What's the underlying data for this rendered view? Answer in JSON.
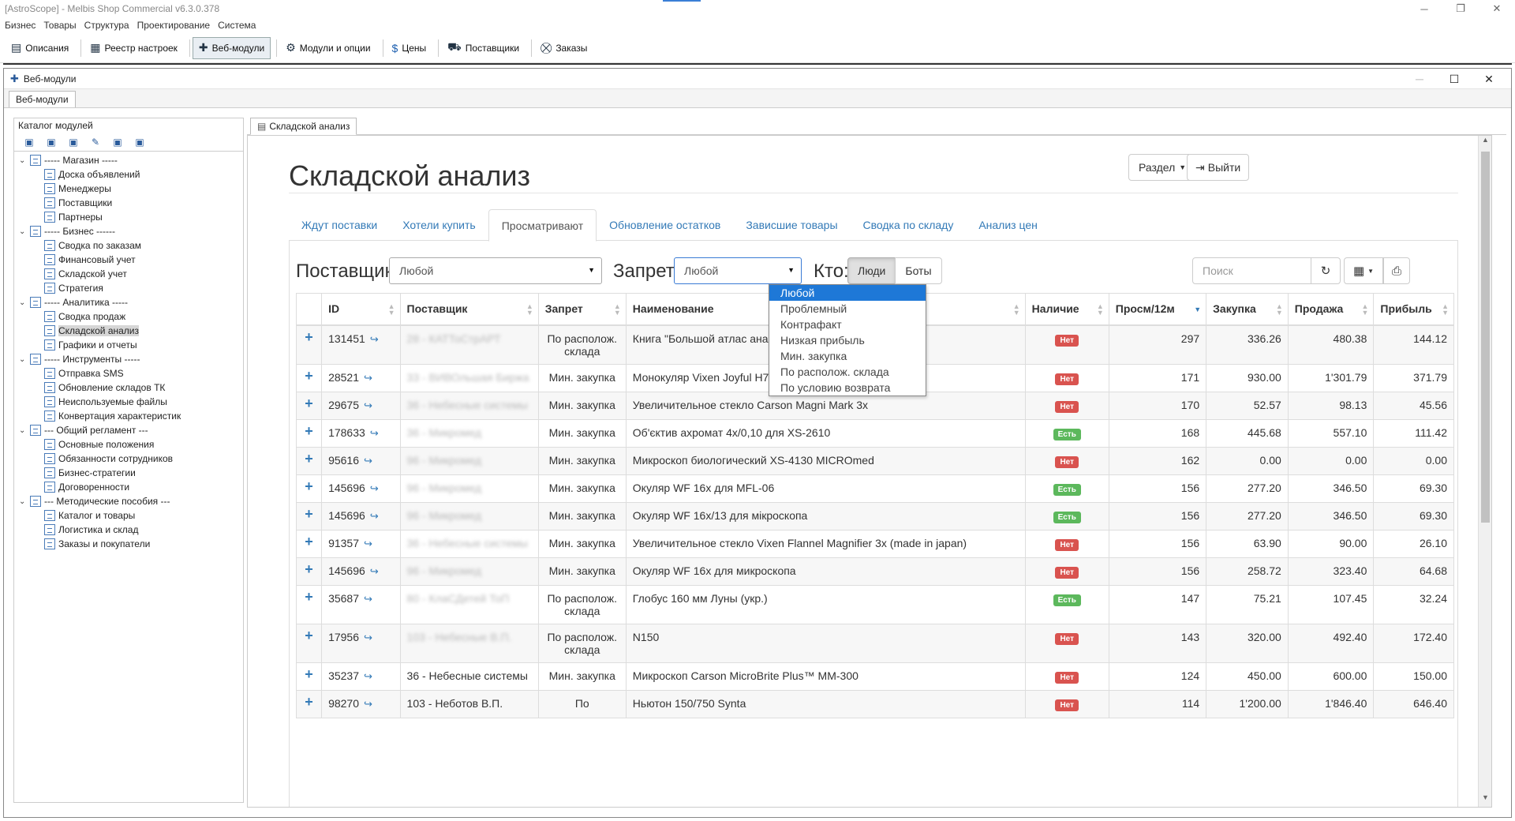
{
  "app": {
    "title": "[AstroScope] - Melbis Shop Commercial v6.3.0.378",
    "menu": [
      "Бизнес",
      "Товары",
      "Структура",
      "Проектирование",
      "Система"
    ],
    "toolbar": [
      {
        "icon": "doc-icon",
        "label": "Описания"
      },
      {
        "icon": "registry-icon",
        "label": "Реестр настроек"
      },
      {
        "icon": "puzzle-icon",
        "label": "Веб-модули",
        "active": true
      },
      {
        "icon": "gear-icon",
        "label": "Модули и опции"
      },
      {
        "icon": "dollar-icon",
        "label": "Цены"
      },
      {
        "icon": "truck-icon",
        "label": "Поставщики"
      },
      {
        "icon": "cart-icon",
        "label": "Заказы"
      }
    ]
  },
  "child": {
    "title": "Веб-модули",
    "tab": "Веб-модули",
    "catalog_title": "Каталог модулей",
    "right_tab": "Складской анализ"
  },
  "tree": [
    {
      "label": "----- Магазин -----",
      "group": true
    },
    {
      "label": "Доска объявлений"
    },
    {
      "label": "Менеджеры"
    },
    {
      "label": "Поставщики"
    },
    {
      "label": "Партнеры"
    },
    {
      "label": "----- Бизнес ------",
      "group": true
    },
    {
      "label": "Сводка по заказам"
    },
    {
      "label": "Финансовый учет"
    },
    {
      "label": "Складской учет"
    },
    {
      "label": "Стратегия"
    },
    {
      "label": "----- Аналитика -----",
      "group": true
    },
    {
      "label": "Сводка продаж"
    },
    {
      "label": "Складской анализ",
      "selected": true
    },
    {
      "label": "Графики и отчеты"
    },
    {
      "label": "----- Инструменты -----",
      "group": true
    },
    {
      "label": "Отправка SMS"
    },
    {
      "label": "Обновление складов ТК"
    },
    {
      "label": "Неиспользуемые файлы"
    },
    {
      "label": "Конвертация характеристик"
    },
    {
      "label": "--- Общий регламент ---",
      "group": true
    },
    {
      "label": "Основные положения"
    },
    {
      "label": "Обязанности сотрудников"
    },
    {
      "label": "Бизнес-стратегии"
    },
    {
      "label": "Договоренности"
    },
    {
      "label": "--- Методические пособия ---",
      "group": true
    },
    {
      "label": "Каталог и товары"
    },
    {
      "label": "Логистика и склад"
    },
    {
      "label": "Заказы и покупатели"
    }
  ],
  "page": {
    "title": "Складской анализ",
    "section_btn": "Раздел",
    "exit_btn": "Выйти",
    "tabs": [
      "Ждут поставки",
      "Хотели купить",
      "Просматривают",
      "Обновление остатков",
      "Зависшие товары",
      "Сводка по складу",
      "Анализ цен"
    ],
    "active_tab": 2,
    "filters": {
      "supplier_label": "Поставщик:",
      "supplier_value": "Любой",
      "ban_label": "Запрет:",
      "ban_value": "Любой",
      "who_label": "Кто:",
      "who_options": [
        "Люди",
        "Боты"
      ],
      "search_placeholder": "Поиск"
    },
    "ban_options": [
      "Любой",
      "Проблемный",
      "Контрафакт",
      "Низкая прибыль",
      "Мин. закупка",
      "По располож. склада",
      "По условию возврата"
    ],
    "columns": [
      "ID",
      "Поставщик",
      "Запрет",
      "Наименование",
      "Наличие",
      "Просм/12м",
      "Закупка",
      "Продажа",
      "Прибыль"
    ],
    "status": {
      "no": "Нет",
      "yes": "Есть"
    },
    "rows": [
      {
        "id": "131451",
        "supplier": "28 - КАТТоСтрАРТ",
        "blur": true,
        "ban": "По располож. склада",
        "name": "Книга \"Большой атлас ана",
        "stock": "no",
        "views": "297",
        "buy": "336.26",
        "sell": "480.38",
        "profit": "144.12"
      },
      {
        "id": "28521",
        "supplier": "33 - ВИВОльшая Биржа",
        "blur": true,
        "ban": "Мин. закупка",
        "name": "Монокуляр Vixen Joyful H7-21x21",
        "stock": "no",
        "views": "171",
        "buy": "930.00",
        "sell": "1'301.79",
        "profit": "371.79"
      },
      {
        "id": "29675",
        "supplier": "36 - Небесные системы",
        "blur": true,
        "ban": "Мин. закупка",
        "name": "Увеличительное стекло Carson Magni Mark 3x",
        "stock": "no",
        "views": "170",
        "buy": "52.57",
        "sell": "98.13",
        "profit": "45.56"
      },
      {
        "id": "178633",
        "supplier": "36 - Микромед",
        "blur": true,
        "ban": "Мин. закупка",
        "name": "Об'єктив ахромат 4x/0,10 для XS-2610",
        "stock": "yes",
        "views": "168",
        "buy": "445.68",
        "sell": "557.10",
        "profit": "111.42"
      },
      {
        "id": "95616",
        "supplier": "96 - Микромед",
        "blur": true,
        "ban": "Мин. закупка",
        "name": "Микроскоп биологический XS-4130 MICROmed",
        "stock": "no",
        "views": "162",
        "buy": "0.00",
        "sell": "0.00",
        "profit": "0.00"
      },
      {
        "id": "145696",
        "supplier": "96 - Микромед",
        "blur": true,
        "ban": "Мин. закупка",
        "name": "Окуляр WF 16x для MFL-06",
        "stock": "yes",
        "views": "156",
        "buy": "277.20",
        "sell": "346.50",
        "profit": "69.30"
      },
      {
        "id": "145696",
        "supplier": "96 - Микромед",
        "blur": true,
        "ban": "Мин. закупка",
        "name": "Окуляр WF 16x/13 для мікроскопа",
        "stock": "yes",
        "views": "156",
        "buy": "277.20",
        "sell": "346.50",
        "profit": "69.30"
      },
      {
        "id": "91357",
        "supplier": "36 - Небесные системы",
        "blur": true,
        "ban": "Мин. закупка",
        "name": "Увеличительное стекло Vixen Flannel Magnifier 3x (made in japan)",
        "stock": "no",
        "views": "156",
        "buy": "63.90",
        "sell": "90.00",
        "profit": "26.10"
      },
      {
        "id": "145696",
        "supplier": "96 - Микромед",
        "blur": true,
        "ban": "Мин. закупка",
        "name": "Окуляр WF 16x для микроскопа",
        "stock": "no",
        "views": "156",
        "buy": "258.72",
        "sell": "323.40",
        "profit": "64.68"
      },
      {
        "id": "35687",
        "supplier": "80 - КлаСДетей ТоП",
        "blur": true,
        "ban": "По располож. склада",
        "name": "Глобус 160 мм Луны (укр.)",
        "stock": "yes",
        "views": "147",
        "buy": "75.21",
        "sell": "107.45",
        "profit": "32.24"
      },
      {
        "id": "17956",
        "supplier": "103 - Небесные В.П.",
        "blur": true,
        "ban": "По располож. склада",
        "name": "N150",
        "stock": "no",
        "views": "143",
        "buy": "320.00",
        "sell": "492.40",
        "profit": "172.40"
      },
      {
        "id": "35237",
        "supplier": "36 - Небесные системы",
        "blur": false,
        "ban": "Мин. закупка",
        "name": "Микроскоп Carson MicroBrite Plus™ MM-300",
        "stock": "no",
        "views": "124",
        "buy": "450.00",
        "sell": "600.00",
        "profit": "150.00"
      },
      {
        "id": "98270",
        "supplier": "103 - Неботов В.П.",
        "blur": false,
        "ban": "По",
        "name": "Ньютон 150/750 Synta",
        "stock": "no",
        "views": "114",
        "buy": "1'200.00",
        "sell": "1'846.40",
        "profit": "646.40"
      }
    ]
  }
}
